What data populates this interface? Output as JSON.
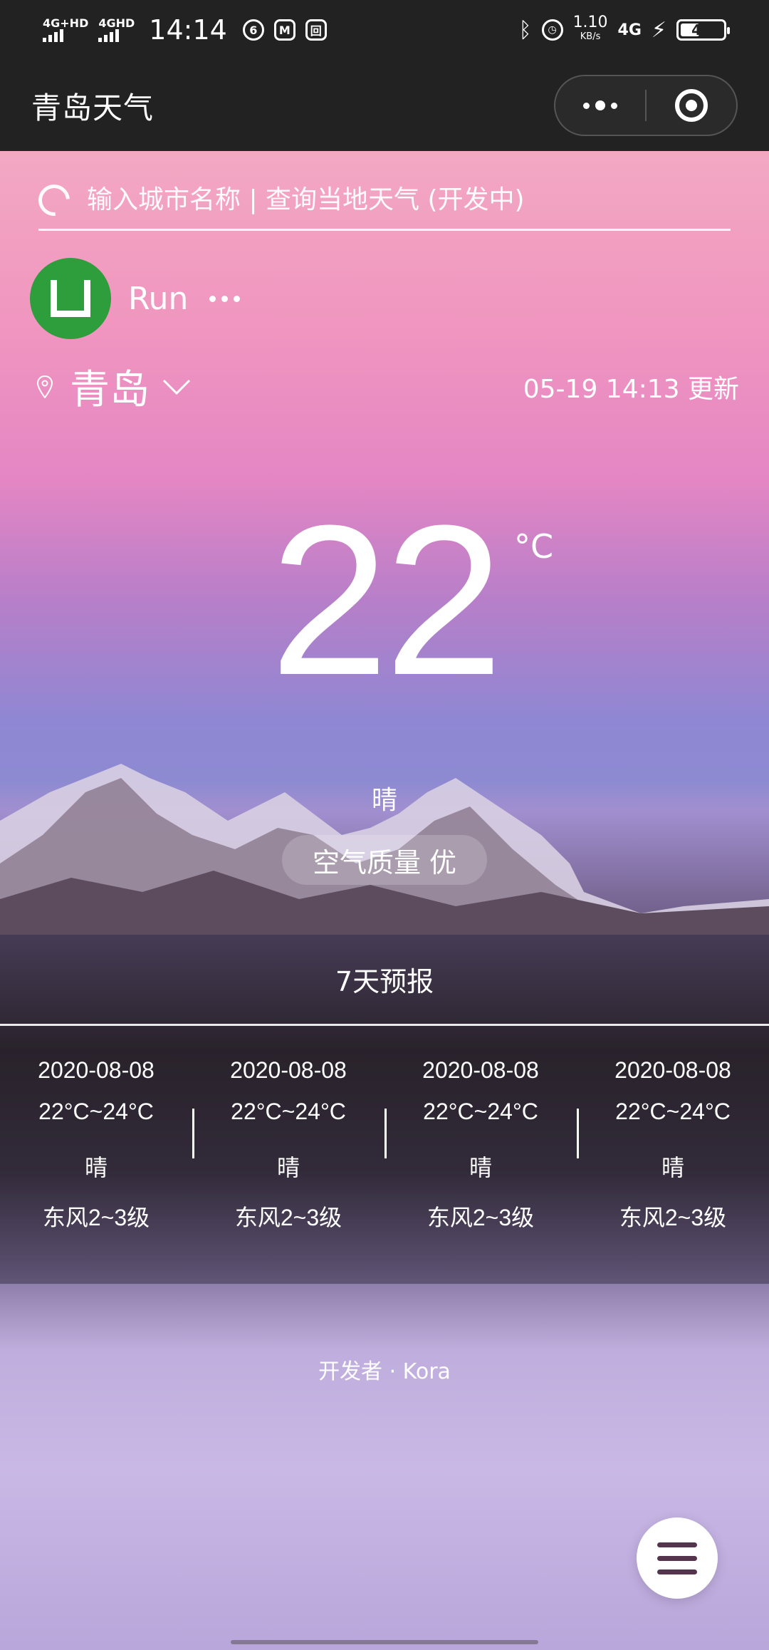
{
  "status_bar": {
    "network1": "4G+HD",
    "network2": "4GHD",
    "time": "14:14",
    "speed_value": "1.10",
    "speed_unit": "KB/s",
    "network3": "4G",
    "battery_level": "43"
  },
  "nav": {
    "title": "青岛天气"
  },
  "search": {
    "placeholder": "输入城市名称 | 查询当地天气 (开发中)"
  },
  "user": {
    "name": "Run"
  },
  "location": {
    "city": "青岛",
    "updated": "05-19 14:13 更新"
  },
  "current": {
    "temperature": "22",
    "unit": "°C",
    "description": "晴",
    "air_quality": "空气质量 优"
  },
  "forecast": {
    "title": "7天预报",
    "days": [
      {
        "date": "2020-08-08",
        "range": "22°C~24°C",
        "desc": "晴",
        "wind": "东风2~3级"
      },
      {
        "date": "2020-08-08",
        "range": "22°C~24°C",
        "desc": "晴",
        "wind": "东风2~3级"
      },
      {
        "date": "2020-08-08",
        "range": "22°C~24°C",
        "desc": "晴",
        "wind": "东风2~3级"
      },
      {
        "date": "2020-08-08",
        "range": "22°C~24°C",
        "desc": "晴",
        "wind": "东风2~3级"
      }
    ]
  },
  "footer": {
    "credit": "开发者 · Kora"
  },
  "colors": {
    "bar_bg": "#222222",
    "avatar_green": "#2e9d3c",
    "menu_icon": "#55354e"
  }
}
